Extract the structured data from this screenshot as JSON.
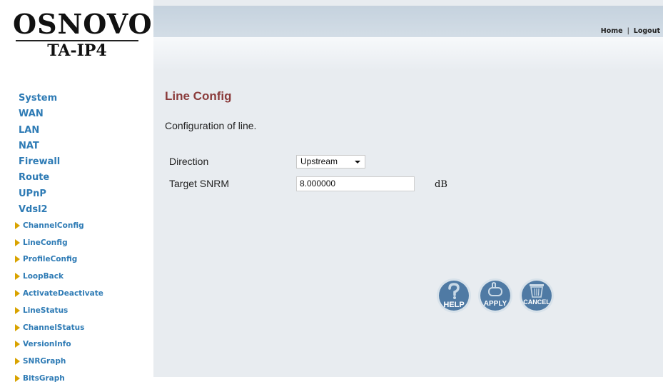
{
  "brand": {
    "name": "OSNOVO",
    "model": "TA-IP4"
  },
  "header": {
    "home": "Home",
    "sep": "|",
    "logout": "Logout"
  },
  "nav": [
    "System",
    "WAN",
    "LAN",
    "NAT",
    "Firewall",
    "Route",
    "UPnP",
    "Vdsl2"
  ],
  "subnav": [
    "ChannelConfig",
    "LineConfig",
    "ProfileConfig",
    "LoopBack",
    "ActivateDeactivate",
    "LineStatus",
    "ChannelStatus",
    "VersionInfo",
    "SNRGraph",
    "BitsGraph"
  ],
  "page": {
    "title": "Line Config",
    "description": "Configuration of line.",
    "direction_label": "Direction",
    "direction_value": "Upstream",
    "snrm_label": "Target SNRM",
    "snrm_value": "8.000000",
    "snrm_unit": "dB"
  },
  "buttons": {
    "help": "HELP",
    "apply": "APPLY",
    "cancel": "CANCEL"
  }
}
